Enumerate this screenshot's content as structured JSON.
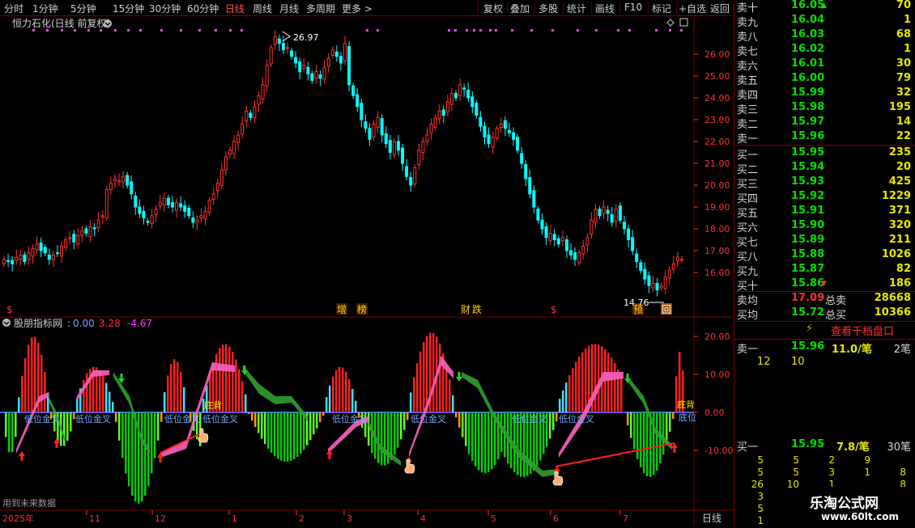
{
  "toolbar": {
    "tabs": [
      "分时",
      "1分钟",
      "5分钟",
      "15分钟",
      "30分钟",
      "60分钟",
      "日线",
      "周线",
      "月线",
      "多周期",
      "更多 >"
    ],
    "active_tab": "日线",
    "right_buttons": [
      "复权",
      "叠加",
      "多股",
      "统计",
      "画线",
      "F10",
      "标记",
      "+自选",
      "返回"
    ]
  },
  "colors": {
    "up": "#ff3030",
    "down": "#00ffff",
    "grid": "#7a0000",
    "axis_text": "#ff3030",
    "vol": "#e8e800",
    "buy_green": "#00e000"
  },
  "main_chart": {
    "title": "恒力石化(日线 前复权)",
    "high_label": "26.97",
    "low_label": "14.76",
    "y_ticks": [
      "26.00",
      "25.00",
      "24.00",
      "23.00",
      "22.00",
      "21.00",
      "20.00",
      "19.00",
      "18.00",
      "17.00",
      "16.00"
    ],
    "markers": [
      {
        "text": "$"
      },
      {
        "text": "增"
      },
      {
        "text": "榜"
      },
      {
        "text": "财"
      },
      {
        "text": "跌"
      },
      {
        "text": "$"
      },
      {
        "text": "预"
      },
      {
        "text": "回"
      }
    ]
  },
  "indicator": {
    "name": "股朋指标网",
    "v1": "0.00",
    "v2": "3.28",
    "v3": "-4.67",
    "y_ticks": [
      "20.00",
      "10.00",
      "0.00",
      "-10.00"
    ],
    "labels": [
      "低位金叉",
      "低位金叉",
      "低位金叉",
      "低位金叉",
      "低位金叉",
      "低位金叉",
      "低位金叉",
      "低位金叉",
      "底背",
      "底背",
      "底位"
    ],
    "future_note": "用到未来数据"
  },
  "x_axis": {
    "labels": [
      "2025年",
      "11",
      "12",
      "1",
      "2",
      "3",
      "4",
      "5",
      "6",
      "7"
    ],
    "period": "日线"
  },
  "orderbook": {
    "asks": [
      {
        "label": "卖十",
        "price": "16.05",
        "vol": "70"
      },
      {
        "label": "卖九",
        "price": "16.04",
        "vol": "1"
      },
      {
        "label": "卖八",
        "price": "16.03",
        "vol": "68"
      },
      {
        "label": "卖七",
        "price": "16.02",
        "vol": "1"
      },
      {
        "label": "卖六",
        "price": "16.01",
        "vol": "30"
      },
      {
        "label": "卖五",
        "price": "16.00",
        "vol": "79"
      },
      {
        "label": "卖四",
        "price": "15.99",
        "vol": "32"
      },
      {
        "label": "卖三",
        "price": "15.98",
        "vol": "195"
      },
      {
        "label": "卖二",
        "price": "15.97",
        "vol": "14"
      },
      {
        "label": "卖一",
        "price": "15.96",
        "vol": "22"
      }
    ],
    "bids": [
      {
        "label": "买一",
        "price": "15.95",
        "vol": "235"
      },
      {
        "label": "买二",
        "price": "15.94",
        "vol": "20"
      },
      {
        "label": "买三",
        "price": "15.93",
        "vol": "425"
      },
      {
        "label": "买四",
        "price": "15.92",
        "vol": "1229"
      },
      {
        "label": "买五",
        "price": "15.91",
        "vol": "371"
      },
      {
        "label": "买六",
        "price": "15.90",
        "vol": "320"
      },
      {
        "label": "买七",
        "price": "15.89",
        "vol": "211"
      },
      {
        "label": "买八",
        "price": "15.88",
        "vol": "1026"
      },
      {
        "label": "买九",
        "price": "15.87",
        "vol": "82"
      },
      {
        "label": "买十",
        "price": "15.86",
        "vol": "186"
      }
    ],
    "avg_ask_label": "卖均",
    "avg_ask": "17.09",
    "total_ask_label": "总卖",
    "total_ask": "28668",
    "avg_bid_label": "买均",
    "avg_bid": "15.72",
    "total_bid_label": "总买",
    "total_bid": "10366",
    "level1000_button": "查看千档盘口",
    "ask1_label": "卖一",
    "ask1_price": "15.96",
    "ask1_per": "11.0/笔",
    "ask1_count": "2笔",
    "ask1_queue": [
      "12",
      "10"
    ],
    "bid1_label": "买一",
    "bid1_price": "15.95",
    "bid1_per": "7.8/笔",
    "bid1_count": "30笔",
    "bid1_queue": [
      [
        "5",
        "5",
        "2",
        "9"
      ],
      [
        "5",
        "5",
        "3",
        "1",
        "8"
      ],
      [
        "26",
        "10",
        "1",
        "",
        "8"
      ],
      [
        "3"
      ],
      [
        "5"
      ],
      [
        "1"
      ]
    ]
  },
  "watermark": {
    "name": "乐淘公式网",
    "url": "www.60lt.com"
  }
}
